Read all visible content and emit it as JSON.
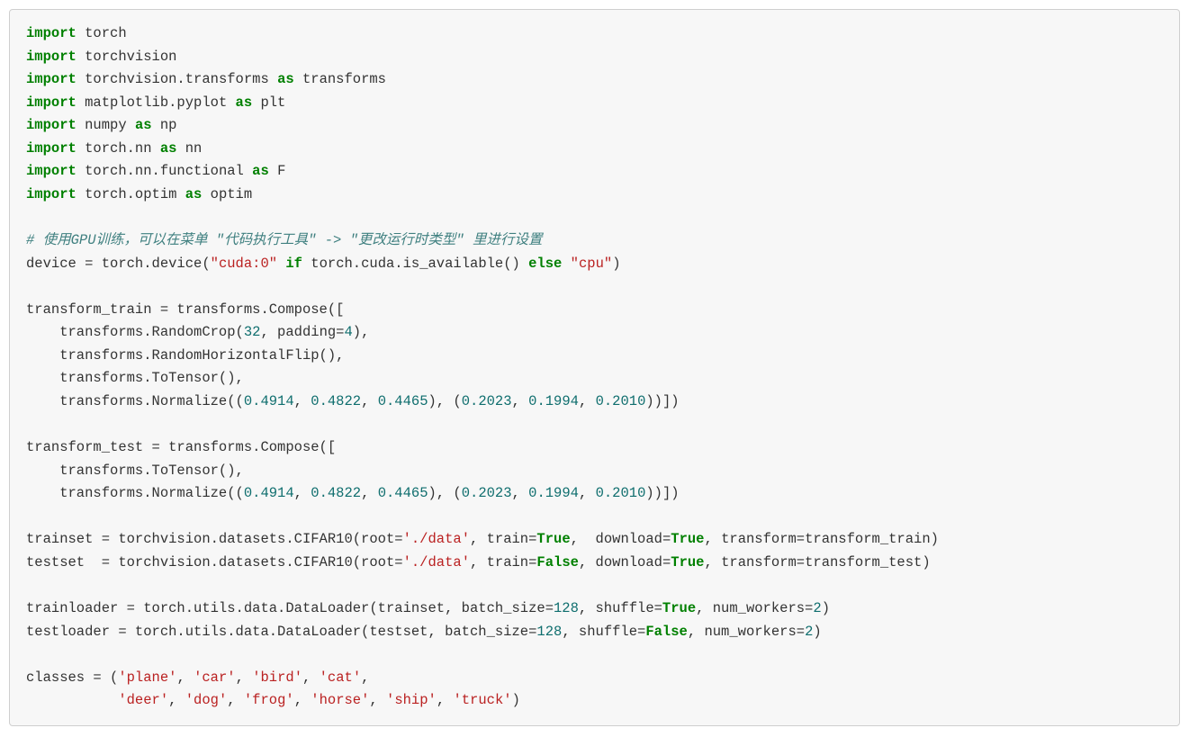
{
  "code": {
    "lines": [
      [
        [
          "import",
          "kw"
        ],
        [
          " torch",
          "plain"
        ]
      ],
      [
        [
          "import",
          "kw"
        ],
        [
          " torchvision",
          "plain"
        ]
      ],
      [
        [
          "import",
          "kw"
        ],
        [
          " torchvision.transforms ",
          "plain"
        ],
        [
          "as",
          "kw"
        ],
        [
          " transforms",
          "plain"
        ]
      ],
      [
        [
          "import",
          "kw"
        ],
        [
          " matplotlib.pyplot ",
          "plain"
        ],
        [
          "as",
          "kw"
        ],
        [
          " plt",
          "plain"
        ]
      ],
      [
        [
          "import",
          "kw"
        ],
        [
          " numpy ",
          "plain"
        ],
        [
          "as",
          "kw"
        ],
        [
          " np",
          "plain"
        ]
      ],
      [
        [
          "import",
          "kw"
        ],
        [
          " torch.nn ",
          "plain"
        ],
        [
          "as",
          "kw"
        ],
        [
          " nn",
          "plain"
        ]
      ],
      [
        [
          "import",
          "kw"
        ],
        [
          " torch.nn.functional ",
          "plain"
        ],
        [
          "as",
          "kw"
        ],
        [
          " F",
          "plain"
        ]
      ],
      [
        [
          "import",
          "kw"
        ],
        [
          " torch.optim ",
          "plain"
        ],
        [
          "as",
          "kw"
        ],
        [
          " optim",
          "plain"
        ]
      ],
      [
        [
          "",
          "plain"
        ]
      ],
      [
        [
          "# 使用GPU训练，可以在菜单 \"代码执行工具\" -> \"更改运行时类型\" 里进行设置",
          "cmt"
        ]
      ],
      [
        [
          "device = torch.device(",
          "plain"
        ],
        [
          "\"cuda:0\"",
          "str"
        ],
        [
          " ",
          "plain"
        ],
        [
          "if",
          "kw"
        ],
        [
          " torch.cuda.is_available() ",
          "plain"
        ],
        [
          "else",
          "kw"
        ],
        [
          " ",
          "plain"
        ],
        [
          "\"cpu\"",
          "str"
        ],
        [
          ")",
          "plain"
        ]
      ],
      [
        [
          "",
          "plain"
        ]
      ],
      [
        [
          "transform_train = transforms.Compose([",
          "plain"
        ]
      ],
      [
        [
          "    transforms.RandomCrop(",
          "plain"
        ],
        [
          "32",
          "num"
        ],
        [
          ", padding=",
          "plain"
        ],
        [
          "4",
          "num"
        ],
        [
          "),",
          "plain"
        ]
      ],
      [
        [
          "    transforms.RandomHorizontalFlip(),",
          "plain"
        ]
      ],
      [
        [
          "    transforms.ToTensor(),",
          "plain"
        ]
      ],
      [
        [
          "    transforms.Normalize((",
          "plain"
        ],
        [
          "0.4914",
          "num"
        ],
        [
          ", ",
          "plain"
        ],
        [
          "0.4822",
          "num"
        ],
        [
          ", ",
          "plain"
        ],
        [
          "0.4465",
          "num"
        ],
        [
          "), (",
          "plain"
        ],
        [
          "0.2023",
          "num"
        ],
        [
          ", ",
          "plain"
        ],
        [
          "0.1994",
          "num"
        ],
        [
          ", ",
          "plain"
        ],
        [
          "0.2010",
          "num"
        ],
        [
          "))])",
          "plain"
        ]
      ],
      [
        [
          "",
          "plain"
        ]
      ],
      [
        [
          "transform_test = transforms.Compose([",
          "plain"
        ]
      ],
      [
        [
          "    transforms.ToTensor(),",
          "plain"
        ]
      ],
      [
        [
          "    transforms.Normalize((",
          "plain"
        ],
        [
          "0.4914",
          "num"
        ],
        [
          ", ",
          "plain"
        ],
        [
          "0.4822",
          "num"
        ],
        [
          ", ",
          "plain"
        ],
        [
          "0.4465",
          "num"
        ],
        [
          "), (",
          "plain"
        ],
        [
          "0.2023",
          "num"
        ],
        [
          ", ",
          "plain"
        ],
        [
          "0.1994",
          "num"
        ],
        [
          ", ",
          "plain"
        ],
        [
          "0.2010",
          "num"
        ],
        [
          "))])",
          "plain"
        ]
      ],
      [
        [
          "",
          "plain"
        ]
      ],
      [
        [
          "trainset = torchvision.datasets.CIFAR10(root=",
          "plain"
        ],
        [
          "'./data'",
          "str"
        ],
        [
          ", train=",
          "plain"
        ],
        [
          "True",
          "bool"
        ],
        [
          ",  download=",
          "plain"
        ],
        [
          "True",
          "bool"
        ],
        [
          ", transform=transform_train)",
          "plain"
        ]
      ],
      [
        [
          "testset  = torchvision.datasets.CIFAR10(root=",
          "plain"
        ],
        [
          "'./data'",
          "str"
        ],
        [
          ", train=",
          "plain"
        ],
        [
          "False",
          "bool"
        ],
        [
          ", download=",
          "plain"
        ],
        [
          "True",
          "bool"
        ],
        [
          ", transform=transform_test)",
          "plain"
        ]
      ],
      [
        [
          "",
          "plain"
        ]
      ],
      [
        [
          "trainloader = torch.utils.data.DataLoader(trainset, batch_size=",
          "plain"
        ],
        [
          "128",
          "num"
        ],
        [
          ", shuffle=",
          "plain"
        ],
        [
          "True",
          "bool"
        ],
        [
          ", num_workers=",
          "plain"
        ],
        [
          "2",
          "num"
        ],
        [
          ")",
          "plain"
        ]
      ],
      [
        [
          "testloader = torch.utils.data.DataLoader(testset, batch_size=",
          "plain"
        ],
        [
          "128",
          "num"
        ],
        [
          ", shuffle=",
          "plain"
        ],
        [
          "False",
          "bool"
        ],
        [
          ", num_workers=",
          "plain"
        ],
        [
          "2",
          "num"
        ],
        [
          ")",
          "plain"
        ]
      ],
      [
        [
          "",
          "plain"
        ]
      ],
      [
        [
          "classes = (",
          "plain"
        ],
        [
          "'plane'",
          "str"
        ],
        [
          ", ",
          "plain"
        ],
        [
          "'car'",
          "str"
        ],
        [
          ", ",
          "plain"
        ],
        [
          "'bird'",
          "str"
        ],
        [
          ", ",
          "plain"
        ],
        [
          "'cat'",
          "str"
        ],
        [
          ",",
          "plain"
        ]
      ],
      [
        [
          "           ",
          "plain"
        ],
        [
          "'deer'",
          "str"
        ],
        [
          ", ",
          "plain"
        ],
        [
          "'dog'",
          "str"
        ],
        [
          ", ",
          "plain"
        ],
        [
          "'frog'",
          "str"
        ],
        [
          ", ",
          "plain"
        ],
        [
          "'horse'",
          "str"
        ],
        [
          ", ",
          "plain"
        ],
        [
          "'ship'",
          "str"
        ],
        [
          ", ",
          "plain"
        ],
        [
          "'truck'",
          "str"
        ],
        [
          ")",
          "plain"
        ]
      ]
    ]
  }
}
